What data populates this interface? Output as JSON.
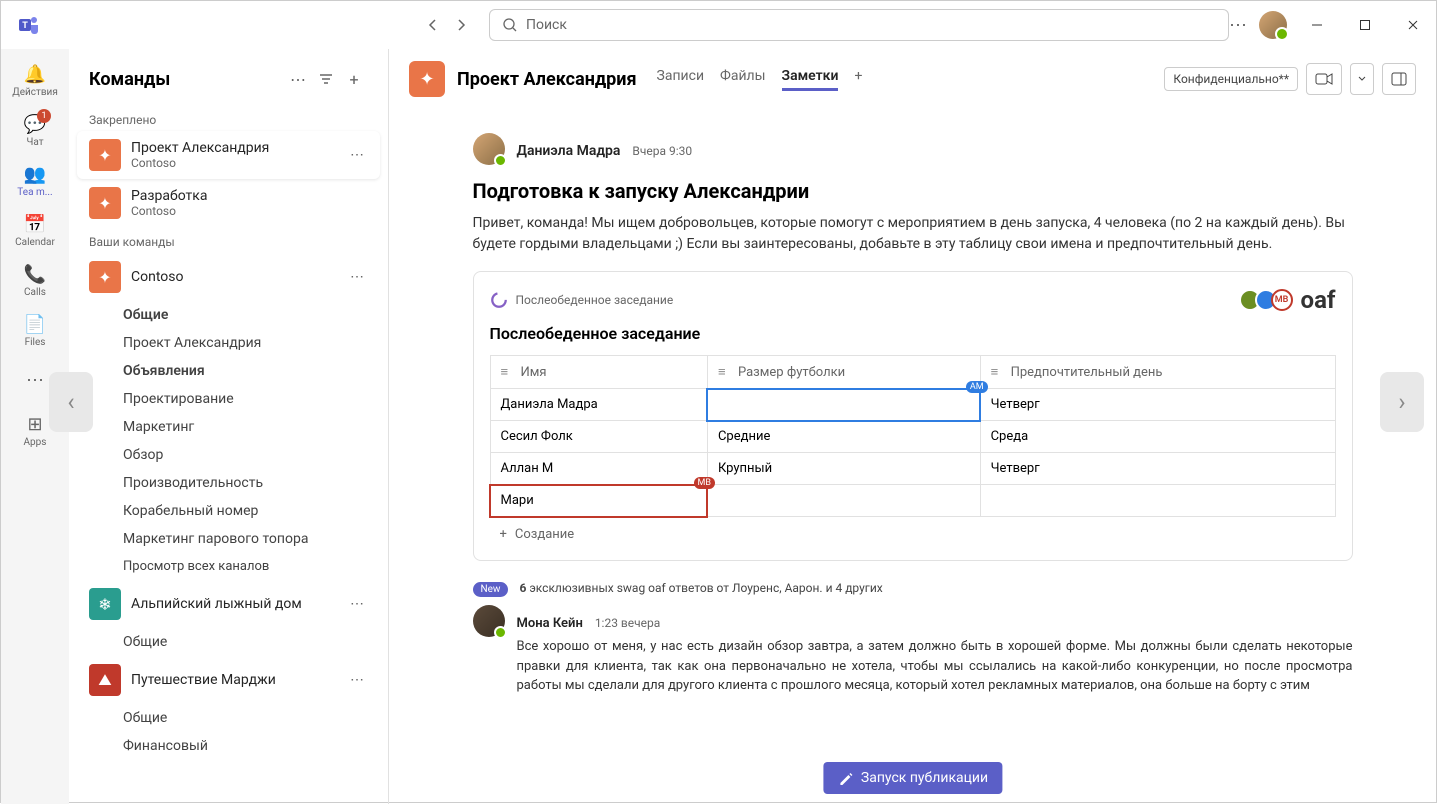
{
  "search": {
    "placeholder": "Поиск"
  },
  "rail": {
    "items": [
      {
        "label": "Действия"
      },
      {
        "label": "Чат",
        "badge": "1"
      },
      {
        "label": "Tea m..."
      },
      {
        "label": "Calendar"
      },
      {
        "label": "Calls"
      },
      {
        "label": "Files"
      },
      {
        "label": ""
      },
      {
        "label": "Apps"
      }
    ]
  },
  "teamlist": {
    "title": "Команды",
    "sections": {
      "pinned": "Закреплено",
      "yours": "Ваши команды"
    },
    "pinned": [
      {
        "name": "Проект Александрия",
        "sub": "Contoso"
      },
      {
        "name": "Разработка",
        "sub": "Contoso"
      }
    ],
    "teams": [
      {
        "name": "Contoso",
        "channels": [
          "Общие",
          "Проект Александрия",
          "Объявления",
          "Проектирование",
          "Маркетинг",
          "Обзор",
          "Производительность",
          "Корабельный номер",
          "Маркетинг парового топора"
        ],
        "seeall": "Просмотр всех каналов"
      },
      {
        "name": "Альпийский лыжный дом",
        "channels": [
          "Общие"
        ]
      },
      {
        "name": "Путешествие Марджи",
        "channels": [
          "Общие",
          "Финансовый"
        ]
      }
    ]
  },
  "channel": {
    "title": "Проект Александрия",
    "tabs": [
      "Записи",
      "Файлы",
      "Заметки"
    ],
    "active_tab": 2,
    "chip": "Конфиденциально**"
  },
  "post": {
    "author": "Даниэла Мадра",
    "time": "Вчера 9:30",
    "title": "Подготовка к запуску Александрии",
    "body": "Привет, команда! Мы ищем добровольцев, которые помогут с мероприятием в день запуска, 4 человека (по 2 на каждый день). Вы будете гордыми владельцами      ;) Если вы заинтересованы, добавьте в эту таблицу свои имена и предпочтительный день."
  },
  "loop": {
    "name": "Послеобеденное заседание",
    "brand": "oaf",
    "title": "Послеобеденное заседание",
    "columns": [
      "Имя",
      "Размер футболки",
      "Предпочтительный день"
    ],
    "rows": [
      {
        "c": [
          "Даниэла Мадра",
          "",
          "Четверг"
        ],
        "blue_col": 1,
        "tag": "AM"
      },
      {
        "c": [
          "Сесил Фолк",
          "Средние",
          "Среда"
        ]
      },
      {
        "c": [
          "Аллан М",
          "Крупный",
          "Четверг"
        ]
      },
      {
        "c": [
          "Мари",
          "",
          ""
        ],
        "red_col": 0,
        "tag": "MB"
      }
    ],
    "add": "Создание"
  },
  "replies": {
    "new_label": "New",
    "count": "6",
    "summary": "эксклюзивных swag oaf ответов от Лоуренс, Аарон. и 4 других",
    "reply": {
      "author": "Мона Кейн",
      "time": "1:23 вечера",
      "body": "Все хорошо от меня, у нас есть дизайн обзор завтра, а затем должно быть в хорошей форме. Мы должны были сделать некоторые правки для клиента, так как она первоначально не хотела, чтобы мы ссылались на какой-либо конкуренции, но после просмотра работы мы сделали для другого клиента с прошлого месяца, который хотел рекламных материалов, она больше на борту с этим"
    }
  },
  "compose": {
    "label": "Запуск публикации"
  }
}
